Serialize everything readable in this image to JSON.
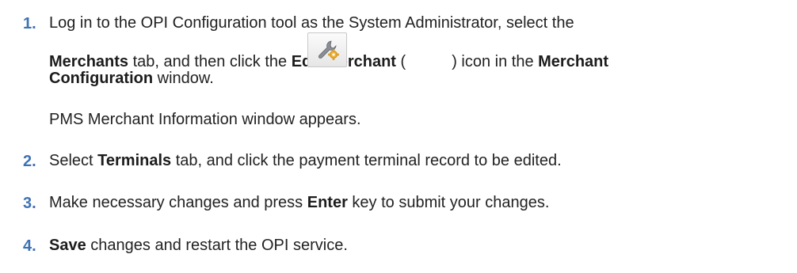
{
  "steps": [
    {
      "num": "1.",
      "line1": "Log in to the OPI Configuration tool as the System Administrator, select the",
      "l2_bold1": "Merchants",
      "l2_t1": " tab, and then click the ",
      "l2_bold2": "Edit Merchant",
      "l2_t2": " (",
      "l2_t3": ") icon in the ",
      "l2_bold3": "Merchant",
      "l3_bold": "Configuration",
      "l3_t": " window.",
      "note": "PMS Merchant Information window appears."
    },
    {
      "num": "2.",
      "t1": "Select ",
      "b1": "Terminals",
      "t2": " tab, and click the payment terminal record to be edited."
    },
    {
      "num": "3.",
      "t1": "Make necessary changes and press ",
      "b1": "Enter",
      "t2": " key to submit your changes."
    },
    {
      "num": "4.",
      "b1": "Save",
      "t1": " changes and restart the OPI service."
    }
  ],
  "icons": {
    "edit_merchant": "wrench-gear-icon"
  },
  "colors": {
    "step_number": "#3f72b5",
    "text": "#222222"
  }
}
